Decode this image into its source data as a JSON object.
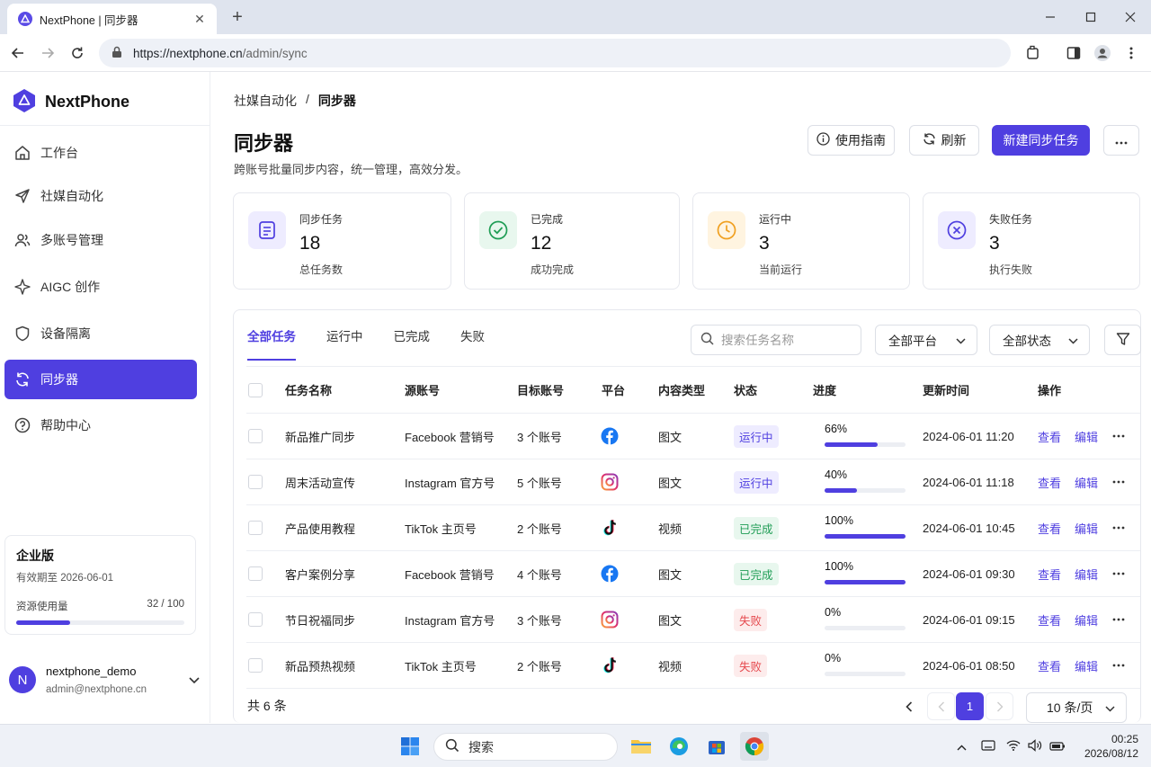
{
  "browser": {
    "tab_title": "NextPhone | 同步器",
    "url_host": "https://nextphone.cn",
    "url_path": "/admin/sync"
  },
  "sidebar": {
    "brand": "NextPhone",
    "items": [
      {
        "label": "工作台",
        "icon": "home-icon"
      },
      {
        "label": "社媒自动化",
        "icon": "send-icon"
      },
      {
        "label": "多账号管理",
        "icon": "users-icon"
      },
      {
        "label": "AIGC 创作",
        "icon": "sparkle-icon"
      },
      {
        "label": "设备隔离",
        "icon": "shield-icon"
      },
      {
        "label": "同步器",
        "icon": "sync-icon",
        "active": true
      },
      {
        "label": "帮助中心",
        "icon": "help-icon"
      }
    ],
    "plan": {
      "title": "企业版",
      "expiry": "有效期至 2026-06-01",
      "usage_label": "资源使用量",
      "usage_value": "32 / 100",
      "usage_fraction": 0.32
    },
    "user": {
      "avatar_letter": "N",
      "username": "nextphone_demo",
      "email": "admin@nextphone.cn"
    }
  },
  "main": {
    "breadcrumb": {
      "parent": "社媒自动化",
      "separator": "/",
      "current": "同步器"
    },
    "title": "同步器",
    "subtitle": "跨账号批量同步内容，统一管理，高效分发。",
    "actions": {
      "guide": "使用指南",
      "refresh": "刷新",
      "create": "新建同步任务"
    },
    "stats": [
      {
        "label": "同步任务",
        "value": "18",
        "desc": "总任务数",
        "color": "#4f3fe0"
      },
      {
        "label": "已完成",
        "value": "12",
        "desc": "成功完成",
        "color": "#1f9d55"
      },
      {
        "label": "运行中",
        "value": "3",
        "desc": "当前运行",
        "color": "#f0a020"
      },
      {
        "label": "失败任务",
        "value": "3",
        "desc": "执行失败",
        "color": "#4f3fe0"
      }
    ],
    "tabs": [
      "全部任务",
      "运行中",
      "已完成",
      "失败"
    ],
    "search_placeholder": "搜索任务名称",
    "platform_filter": "全部平台",
    "status_filter": "全部状态",
    "columns": [
      "任务名称",
      "源账号",
      "目标账号",
      "平台",
      "内容类型",
      "状态",
      "进度",
      "更新时间",
      "操作"
    ],
    "rows": [
      {
        "name": "新品推广同步",
        "source": "Facebook 营销号",
        "target": "3 个账号",
        "platform": "facebook",
        "type": "图文",
        "status": "运行中",
        "status_kind": "running",
        "progress": 66,
        "progress_label": "66%",
        "updated": "2024-06-01 11:20"
      },
      {
        "name": "周末活动宣传",
        "source": "Instagram 官方号",
        "target": "5 个账号",
        "platform": "instagram",
        "type": "图文",
        "status": "运行中",
        "status_kind": "running",
        "progress": 40,
        "progress_label": "40%",
        "updated": "2024-06-01 11:18"
      },
      {
        "name": "产品使用教程",
        "source": "TikTok 主页号",
        "target": "2 个账号",
        "platform": "tiktok",
        "type": "视频",
        "status": "已完成",
        "status_kind": "done",
        "progress": 100,
        "progress_label": "100%",
        "updated": "2024-06-01 10:45"
      },
      {
        "name": "客户案例分享",
        "source": "Facebook 营销号",
        "target": "4 个账号",
        "platform": "facebook",
        "type": "图文",
        "status": "已完成",
        "status_kind": "done",
        "progress": 100,
        "progress_label": "100%",
        "updated": "2024-06-01 09:30"
      },
      {
        "name": "节日祝福同步",
        "source": "Instagram 官方号",
        "target": "3 个账号",
        "platform": "instagram",
        "type": "图文",
        "status": "失败",
        "status_kind": "failed",
        "progress": 0,
        "progress_label": "0%",
        "updated": "2024-06-01 09:15"
      },
      {
        "name": "新品预热视频",
        "source": "TikTok 主页号",
        "target": "2 个账号",
        "platform": "tiktok",
        "type": "视频",
        "status": "失败",
        "status_kind": "failed",
        "progress": 0,
        "progress_label": "0%",
        "updated": "2024-06-01 08:50"
      }
    ],
    "row_actions": {
      "view": "查看",
      "edit": "编辑"
    },
    "total": "共 6 条",
    "current_page": "1",
    "page_size": "10 条/页"
  },
  "taskbar": {
    "search_label": "搜索",
    "time": "00:25",
    "date": "2026/08/12"
  },
  "colors": {
    "accent": "#4f3fe0",
    "running_bg": "#eeecff",
    "done_bg": "#e8f7ee",
    "done_fg": "#1f9d55",
    "failed_bg": "#fdecec",
    "failed_fg": "#e5484d"
  }
}
